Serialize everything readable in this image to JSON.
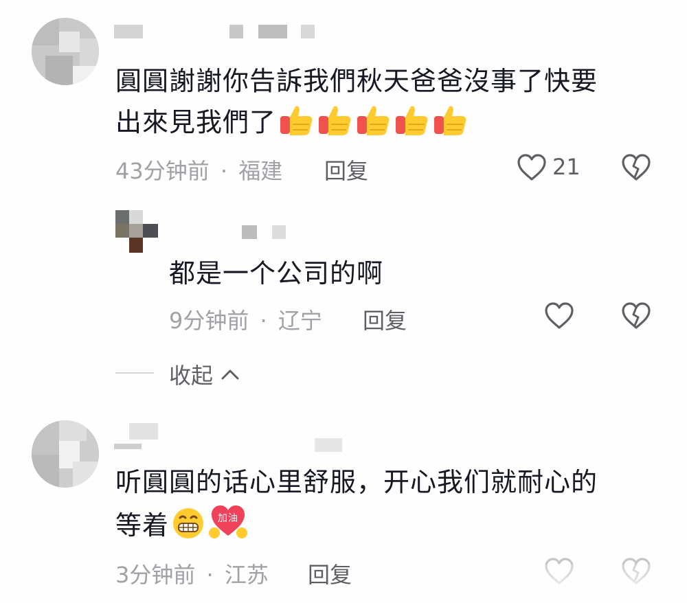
{
  "comments": [
    {
      "text_line1": "圓圓謝謝你告訴我們秋天爸爸沒事了快要",
      "text_line2": "出來見我們了",
      "emoji": [
        "thumbs-up",
        "thumbs-up",
        "thumbs-up",
        "thumbs-up",
        "thumbs-up"
      ],
      "time": "43分钟前",
      "location": "福建",
      "reply_label": "回复",
      "like_count": "21"
    },
    {
      "text_line1": "都是一个公司的啊",
      "time": "9分钟前",
      "location": "辽宁",
      "reply_label": "回复"
    },
    {
      "text_line1": "听圓圓的话心里舒服，开心我们就耐心的",
      "text_line2": "等着",
      "emoji": [
        "grimace-face",
        "jiayou-heart"
      ],
      "emoji_text": "加油",
      "time": "3分钟前",
      "location": "江苏",
      "reply_label": "回复"
    }
  ],
  "separator": "·",
  "collapse_label": "收起",
  "icons": {
    "like": "heart-outline-icon",
    "dislike": "broken-heart-icon",
    "collapse": "chevron-up-icon"
  },
  "colors": {
    "text": "#161823",
    "meta": "#a0a1a6",
    "secondary": "#5e5f66"
  }
}
